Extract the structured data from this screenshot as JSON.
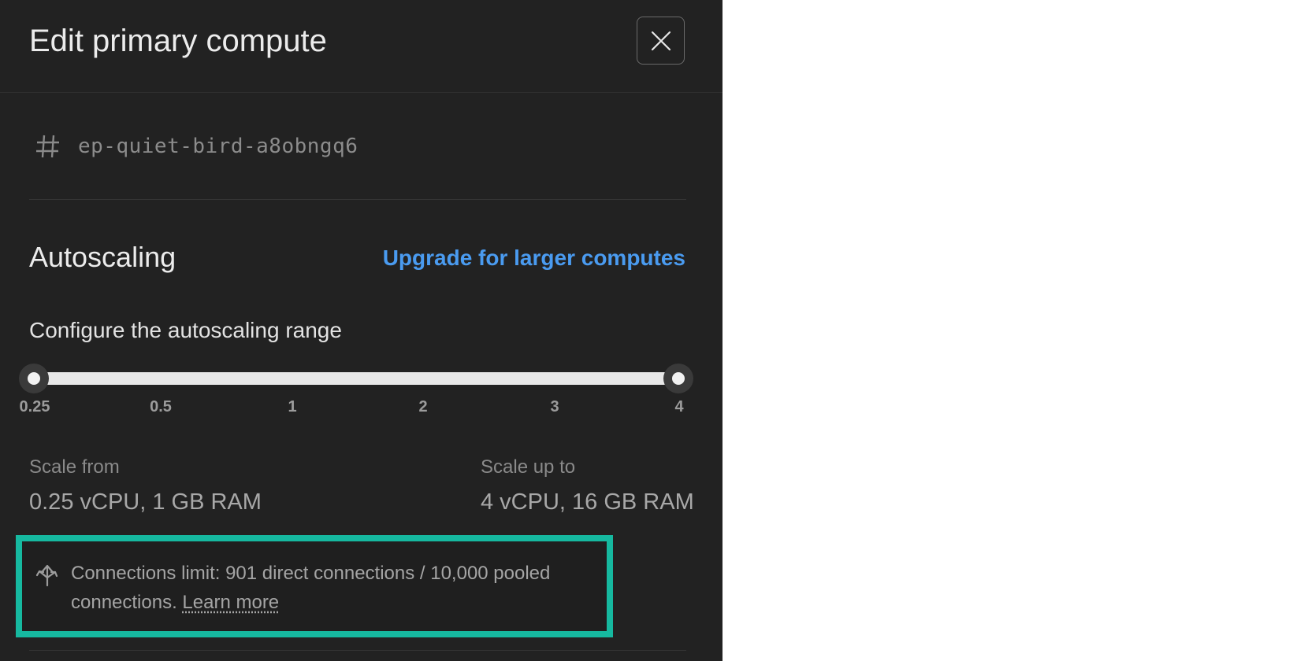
{
  "dialog": {
    "title": "Edit primary compute",
    "close_icon": "close-icon"
  },
  "endpoint": {
    "icon": "hash-icon",
    "id": "ep-quiet-bird-a8obngq6"
  },
  "autoscaling": {
    "title": "Autoscaling",
    "upgrade_link": "Upgrade for larger computes",
    "range_label": "Configure the autoscaling range",
    "slider": {
      "ticks": [
        "0.25",
        "0.5",
        "1",
        "2",
        "3",
        "4"
      ],
      "min_value": "0.25",
      "max_value": "4"
    },
    "scale_from_label": "Scale from",
    "scale_from_value": "0.25 vCPU, 1 GB RAM",
    "scale_up_label": "Scale up to",
    "scale_up_value": "4 vCPU, 16 GB RAM"
  },
  "notice": {
    "icon": "connections-icon",
    "text": "Connections limit: 901 direct connections / 10,000 pooled connections. ",
    "link": "Learn more"
  },
  "colors": {
    "panel_bg": "#222222",
    "accent_link": "#4a9bf0",
    "highlight_border": "#16b9a0"
  }
}
